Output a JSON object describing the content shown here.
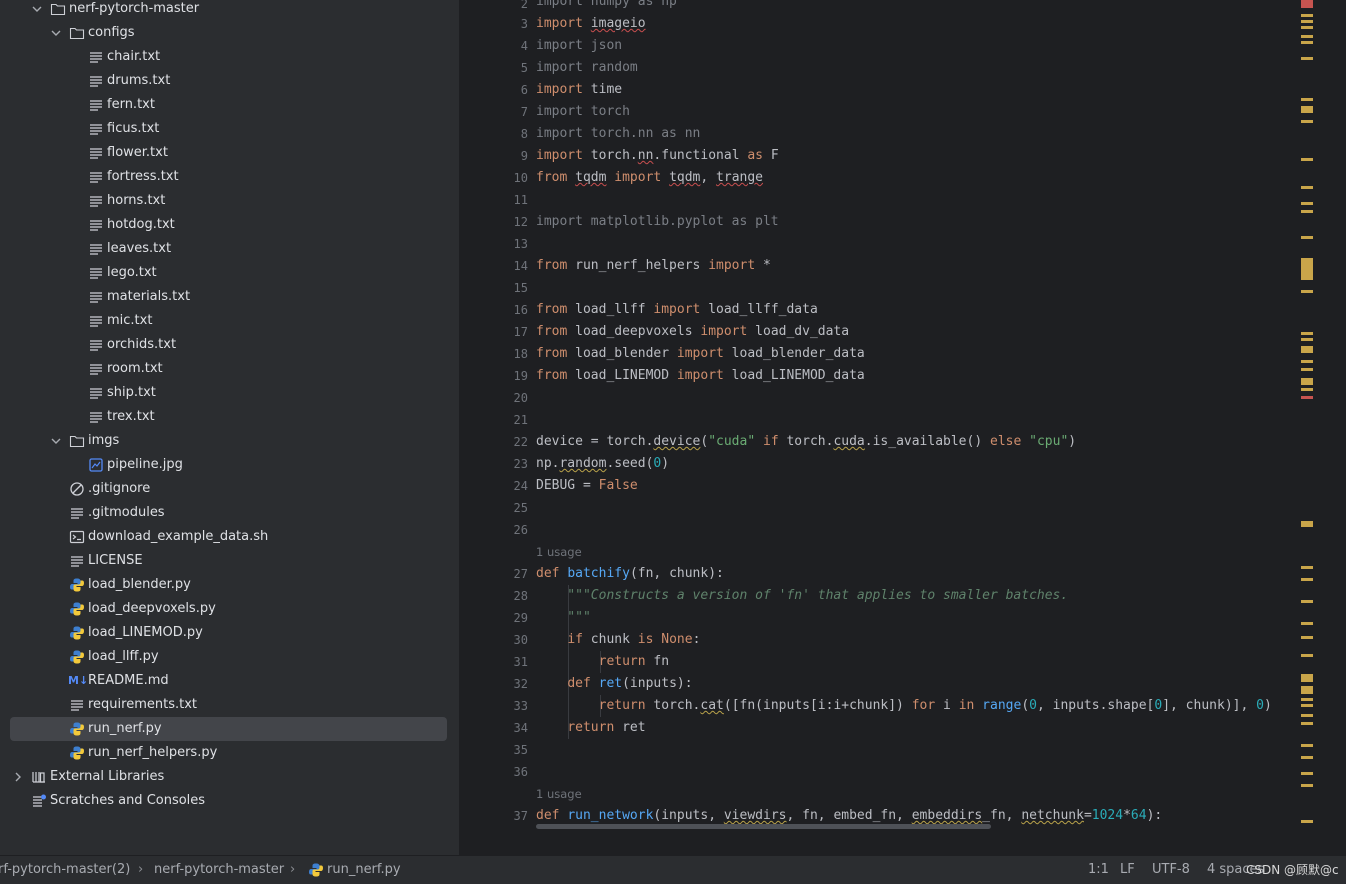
{
  "project_tree": {
    "root": "nerf-pytorch-master",
    "configs_folder": "configs",
    "config_files": [
      "chair.txt",
      "drums.txt",
      "fern.txt",
      "ficus.txt",
      "flower.txt",
      "fortress.txt",
      "horns.txt",
      "hotdog.txt",
      "leaves.txt",
      "lego.txt",
      "materials.txt",
      "mic.txt",
      "orchids.txt",
      "room.txt",
      "ship.txt",
      "trex.txt"
    ],
    "imgs_folder": "imgs",
    "img_files": [
      "pipeline.jpg"
    ],
    "root_files": [
      {
        "name": ".gitignore",
        "icon": "ignore-icon"
      },
      {
        "name": ".gitmodules",
        "icon": "text-file-icon"
      },
      {
        "name": "download_example_data.sh",
        "icon": "shell-script-icon"
      },
      {
        "name": "LICENSE",
        "icon": "text-file-icon"
      },
      {
        "name": "load_blender.py",
        "icon": "python-icon"
      },
      {
        "name": "load_deepvoxels.py",
        "icon": "python-icon"
      },
      {
        "name": "load_LINEMOD.py",
        "icon": "python-icon"
      },
      {
        "name": "load_llff.py",
        "icon": "python-icon"
      },
      {
        "name": "README.md",
        "icon": "markdown-icon"
      },
      {
        "name": "requirements.txt",
        "icon": "text-file-icon"
      },
      {
        "name": "run_nerf.py",
        "icon": "python-icon",
        "selected": true
      },
      {
        "name": "run_nerf_helpers.py",
        "icon": "python-icon"
      }
    ],
    "external_libraries": "External Libraries",
    "scratches": "Scratches and Consoles",
    "markdown_badge": "M↓"
  },
  "editor": {
    "line_numbers": [
      "2",
      "3",
      "4",
      "5",
      "6",
      "7",
      "8",
      "9",
      "10",
      "11",
      "12",
      "13",
      "14",
      "15",
      "16",
      "17",
      "18",
      "19",
      "20",
      "21",
      "22",
      "23",
      "24",
      "25",
      "26",
      "27",
      "28",
      "29",
      "30",
      "31",
      "32",
      "33",
      "34",
      "35",
      "36",
      "37"
    ],
    "usage_hints": [
      "1 usage",
      "1 usage"
    ],
    "code": {
      "l2": "import numpy as np",
      "l3": "import imageio",
      "l4": "import json",
      "l5": "import random",
      "l6": "import time",
      "l7": "import torch",
      "l8": "import torch.nn as nn",
      "l9": "import torch.nn.functional as F",
      "l10": "from tqdm import tqdm, trange",
      "l12": "import matplotlib.pyplot as plt",
      "l14": "from run_nerf_helpers import *",
      "l16": "from load_llff import load_llff_data",
      "l17": "from load_deepvoxels import load_dv_data",
      "l18": "from load_blender import load_blender_data",
      "l19": "from load_LINEMOD import load_LINEMOD_data",
      "l22": "device = torch.device(\"cuda\" if torch.cuda.is_available() else \"cpu\")",
      "l23": "np.random.seed(0)",
      "l24": "DEBUG = False",
      "l27": "def batchify(fn, chunk):",
      "l28": "    \"\"\"Constructs a version of 'fn' that applies to smaller batches.",
      "l29": "    \"\"\"",
      "l30": "    if chunk is None:",
      "l31": "        return fn",
      "l32": "    def ret(inputs):",
      "l33": "        return torch.cat([fn(inputs[i:i+chunk]) for i in range(0, inputs.shape[0], chunk)], 0)",
      "l34": "    return ret",
      "l37": "def run_network(inputs, viewdirs, fn, embed_fn, embeddirs_fn, netchunk=1024*64):"
    }
  },
  "status_bar": {
    "breadcrumb": [
      "rf-pytorch-master(2)",
      "nerf-pytorch-master",
      "run_nerf.py"
    ],
    "position": "1:1",
    "line_ending": "LF",
    "encoding": "UTF-8",
    "indent": "4 spaces",
    "watermark": "CSDN @顾默@c"
  },
  "colors": {
    "keyword": "#cf8e6d",
    "string": "#6aab73",
    "number": "#2aacb8",
    "function": "#56a8f5",
    "docstring": "#5f826b",
    "selection": "#43454a"
  }
}
